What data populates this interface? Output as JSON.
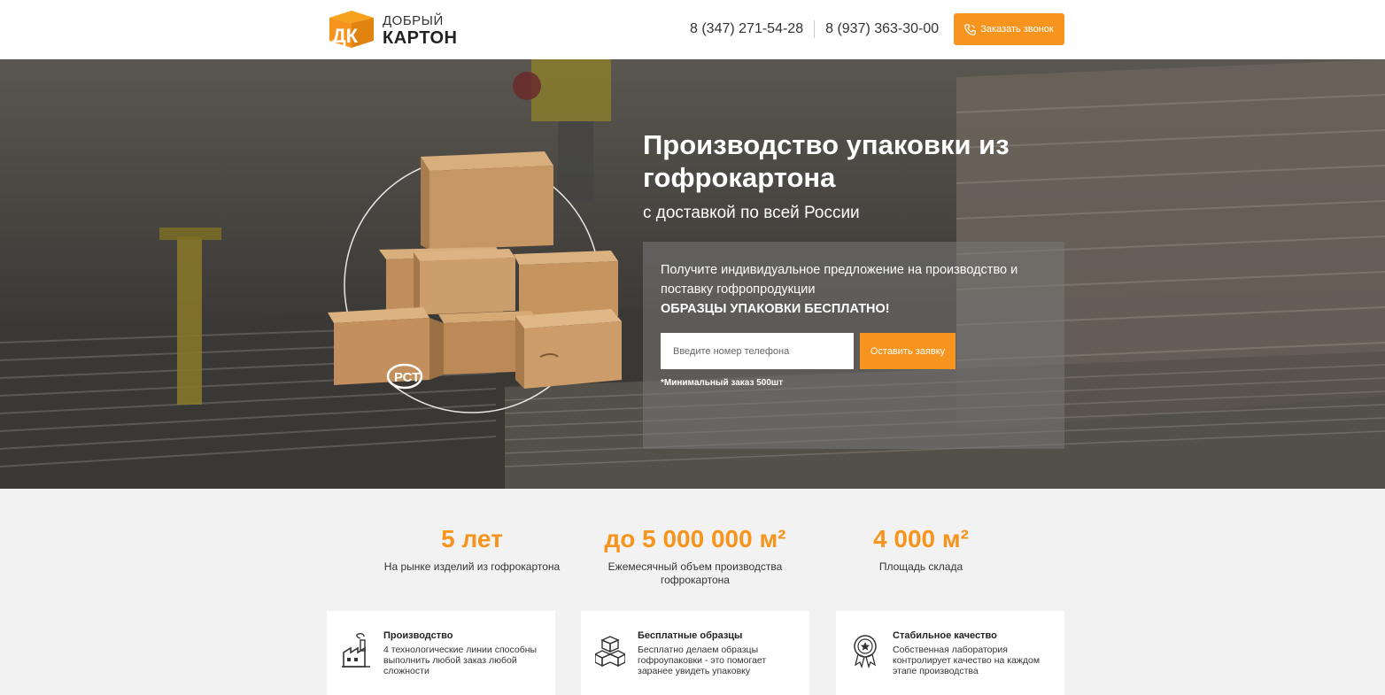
{
  "header": {
    "logo_top": "ДОБРЫЙ",
    "logo_bottom": "КАРТОН",
    "logo_mark": "ДК",
    "phone_1": "8 (347) 271-54-28",
    "phone_2": "8 (937) 363-30-00",
    "call_button": "Заказать звонок"
  },
  "hero": {
    "title": "Производство упаковки из гофрокартона",
    "subtitle": "с доставкой по всей России",
    "offer_line": "Получите индивидуальное предложение на производство и поставку гофропродукции",
    "offer_strong": "ОБРАЗЦЫ УПАКОВКИ БЕСПЛАТНО!",
    "phone_placeholder": "Введите номер телефона",
    "submit_button": "Оставить заявку",
    "min_order": "*Минимальный заказ 500шт",
    "badge": "РСТ"
  },
  "stats": [
    {
      "value": "5 лет",
      "label": "На рынке изделий из гофрокартона"
    },
    {
      "value": "до 5 000 000 м²",
      "label": "Ежемесячный объем производства гофрокартона"
    },
    {
      "value": "4 000 м²",
      "label": "Площадь склада"
    }
  ],
  "features": [
    {
      "title": "Производство",
      "text": "4 технологические линии способны выполнить любой заказ любой сложности",
      "icon": "factory-icon"
    },
    {
      "title": "Бесплатные образцы",
      "text": "Бесплатно делаем образцы гофроупаковки - это помогает заранее увидеть упаковку",
      "icon": "boxes-icon"
    },
    {
      "title": "Стабильное качество",
      "text": "Собственная лаборатория контролирует качество на каждом этапе производства",
      "icon": "quality-badge-icon"
    }
  ],
  "colors": {
    "accent": "#f7941d",
    "hero_overlay": "#4b4843",
    "card_bg": "#ffffff",
    "page_bg": "#f2f2f2"
  }
}
